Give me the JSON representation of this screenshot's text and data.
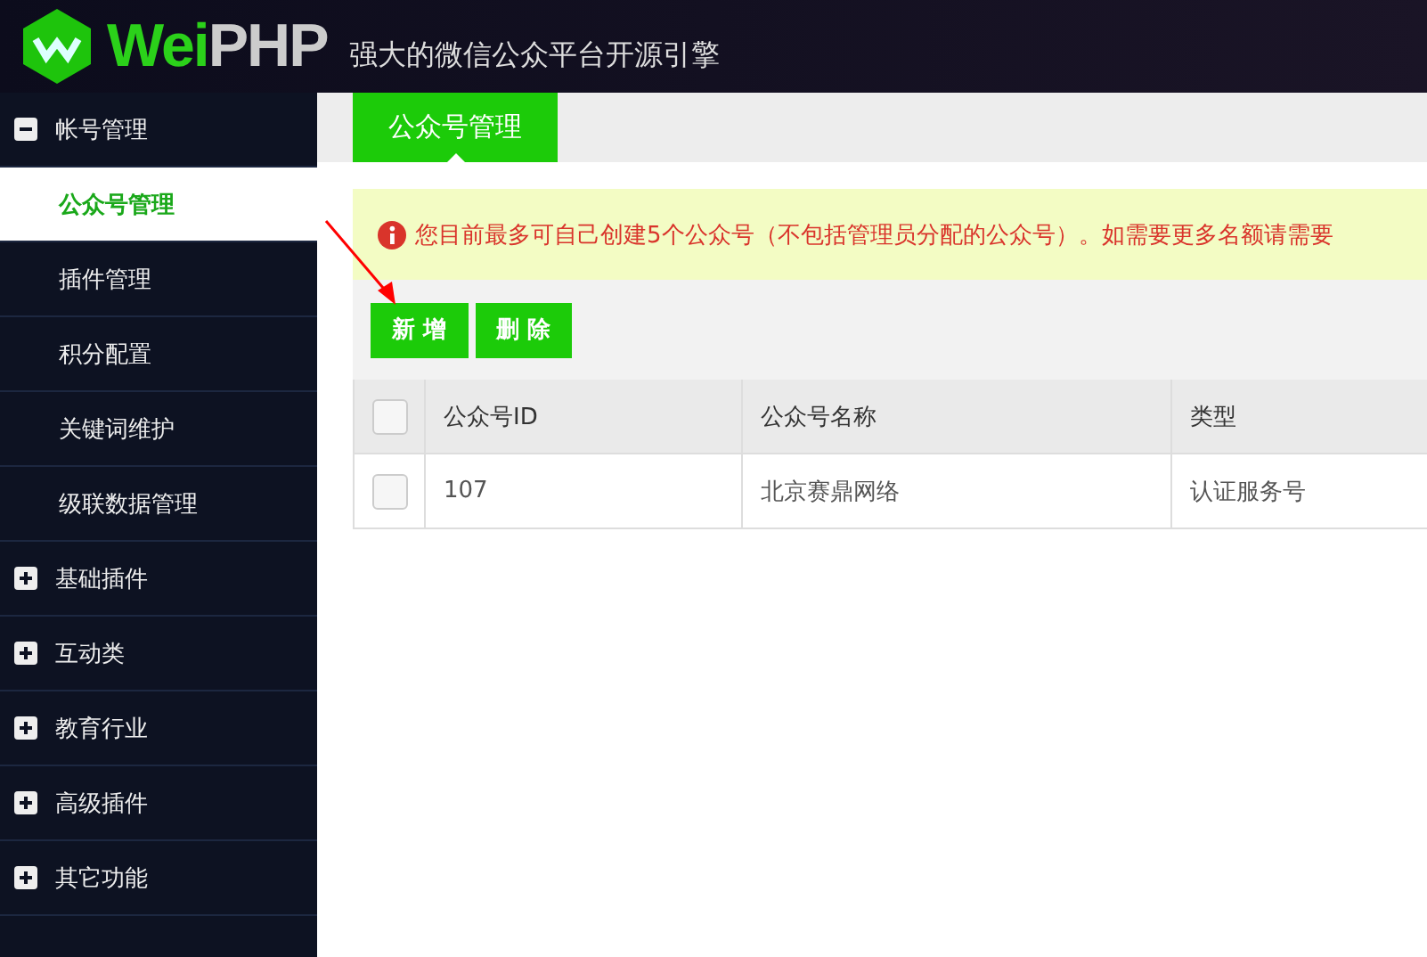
{
  "header": {
    "logo": "WeiPHP",
    "slogan": "强大的微信公众平台开源引擎"
  },
  "sidebar": {
    "groups": [
      {
        "label": "帐号管理",
        "expanded": true,
        "children": [
          {
            "label": "公众号管理",
            "selected": true
          },
          {
            "label": "插件管理",
            "selected": false
          },
          {
            "label": "积分配置",
            "selected": false
          },
          {
            "label": "关键词维护",
            "selected": false
          },
          {
            "label": "级联数据管理",
            "selected": false
          }
        ]
      },
      {
        "label": "基础插件",
        "expanded": false
      },
      {
        "label": "互动类",
        "expanded": false
      },
      {
        "label": "教育行业",
        "expanded": false
      },
      {
        "label": "高级插件",
        "expanded": false
      },
      {
        "label": "其它功能",
        "expanded": false
      }
    ]
  },
  "tabs": [
    {
      "label": "公众号管理",
      "selected": true
    }
  ],
  "notice": "您目前最多可自己创建5个公众号（不包括管理员分配的公众号）。如需要更多名额请需要",
  "buttons": [
    "新 增",
    "删 除"
  ],
  "table": {
    "select_all_checked": false,
    "columns": [
      "公众号ID",
      "公众号名称",
      "类型"
    ],
    "rows": [
      {
        "checked": false,
        "cells": [
          "107",
          "北京赛鼎网络",
          "认证服务号"
        ]
      }
    ]
  }
}
